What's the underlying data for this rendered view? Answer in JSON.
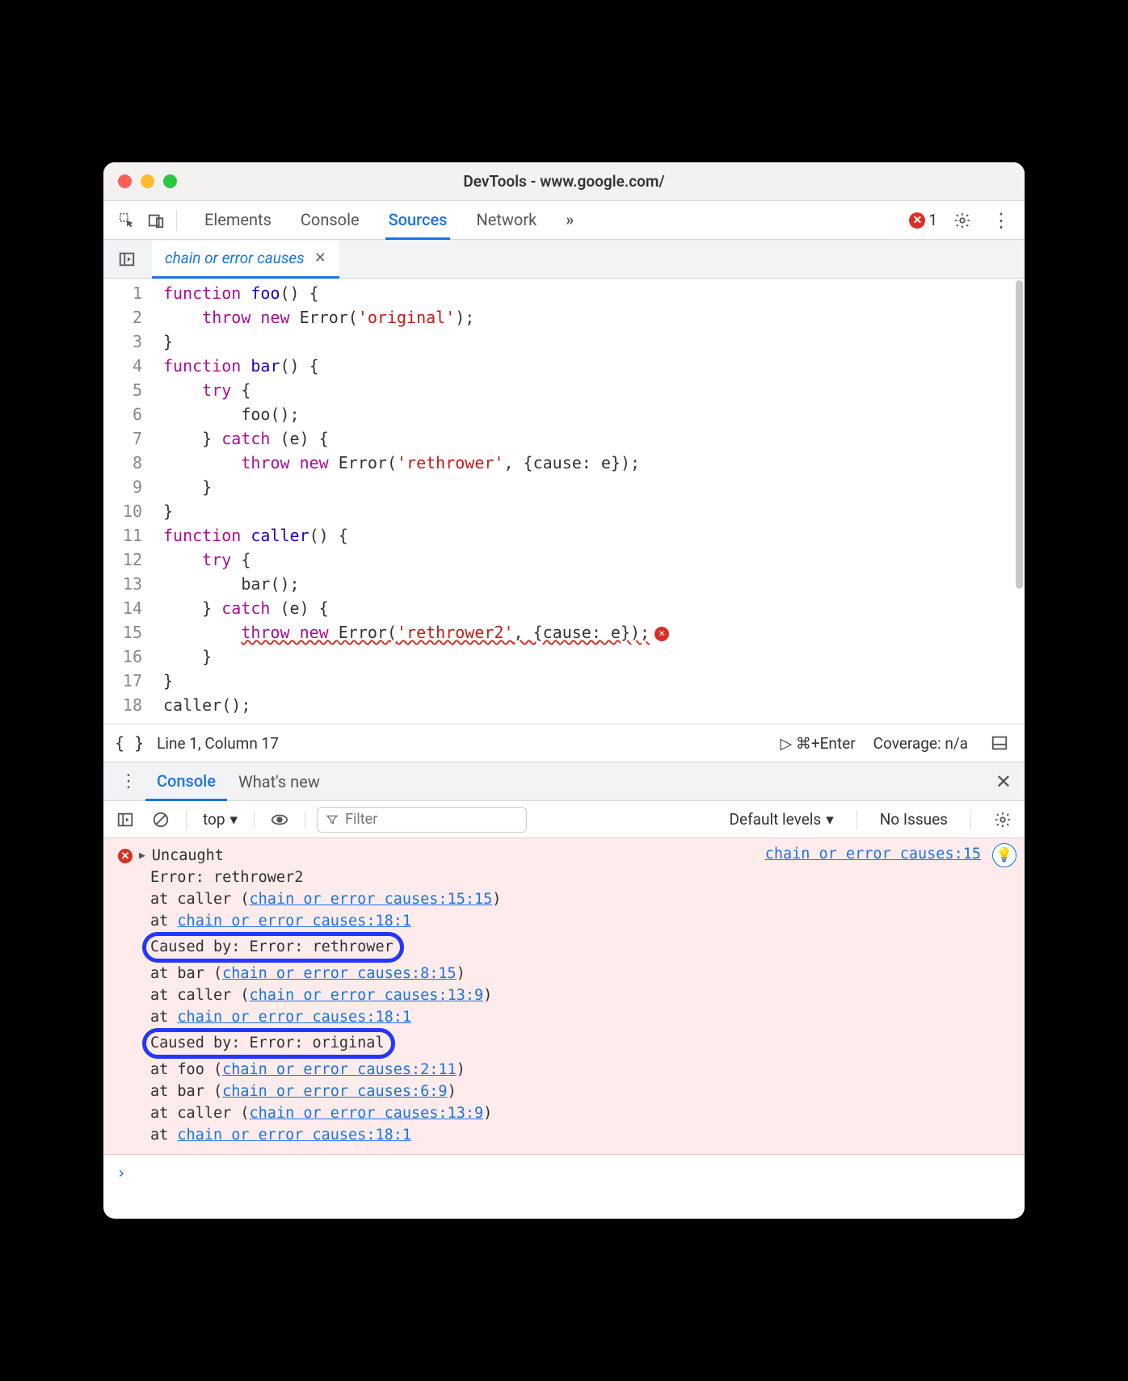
{
  "window": {
    "title": "DevTools - www.google.com/"
  },
  "toolbar": {
    "tabs": [
      "Elements",
      "Console",
      "Sources",
      "Network"
    ],
    "active_tab": "Sources",
    "overflow_glyph": "»",
    "error_count": "1"
  },
  "sources": {
    "file_tab": "chain or error causes",
    "code": {
      "lines": [
        {
          "n": "1",
          "tokens": [
            {
              "t": "function ",
              "c": "kw"
            },
            {
              "t": "foo",
              "c": "fn"
            },
            {
              "t": "() {",
              "c": "pn"
            }
          ]
        },
        {
          "n": "2",
          "tokens": [
            {
              "t": "    throw new ",
              "c": "kw"
            },
            {
              "t": "Error(",
              "c": "pn"
            },
            {
              "t": "'original'",
              "c": "str"
            },
            {
              "t": ");",
              "c": "pn"
            }
          ]
        },
        {
          "n": "3",
          "tokens": [
            {
              "t": "}",
              "c": "pn"
            }
          ]
        },
        {
          "n": "4",
          "tokens": [
            {
              "t": "function ",
              "c": "kw"
            },
            {
              "t": "bar",
              "c": "fn"
            },
            {
              "t": "() {",
              "c": "pn"
            }
          ]
        },
        {
          "n": "5",
          "tokens": [
            {
              "t": "    try ",
              "c": "kw"
            },
            {
              "t": "{",
              "c": "pn"
            }
          ]
        },
        {
          "n": "6",
          "tokens": [
            {
              "t": "        foo();",
              "c": "pn"
            }
          ]
        },
        {
          "n": "7",
          "tokens": [
            {
              "t": "    } ",
              "c": "pn"
            },
            {
              "t": "catch ",
              "c": "kw"
            },
            {
              "t": "(e) {",
              "c": "pn"
            }
          ]
        },
        {
          "n": "8",
          "tokens": [
            {
              "t": "        throw new ",
              "c": "kw"
            },
            {
              "t": "Error(",
              "c": "pn"
            },
            {
              "t": "'rethrower'",
              "c": "str"
            },
            {
              "t": ", {cause: e});",
              "c": "pn"
            }
          ]
        },
        {
          "n": "9",
          "tokens": [
            {
              "t": "    }",
              "c": "pn"
            }
          ]
        },
        {
          "n": "10",
          "tokens": [
            {
              "t": "}",
              "c": "pn"
            }
          ]
        },
        {
          "n": "11",
          "tokens": [
            {
              "t": "function ",
              "c": "kw"
            },
            {
              "t": "caller",
              "c": "fn"
            },
            {
              "t": "() {",
              "c": "pn"
            }
          ]
        },
        {
          "n": "12",
          "tokens": [
            {
              "t": "    try ",
              "c": "kw"
            },
            {
              "t": "{",
              "c": "pn"
            }
          ]
        },
        {
          "n": "13",
          "tokens": [
            {
              "t": "        bar();",
              "c": "pn"
            }
          ]
        },
        {
          "n": "14",
          "tokens": [
            {
              "t": "    } ",
              "c": "pn"
            },
            {
              "t": "catch ",
              "c": "kw"
            },
            {
              "t": "(e) {",
              "c": "pn"
            }
          ]
        },
        {
          "n": "15",
          "tokens": [
            {
              "t": "        ",
              "c": "pn"
            },
            {
              "t": "throw new ",
              "c": "kw",
              "sq": true
            },
            {
              "t": "Error(",
              "c": "pn",
              "sq": true
            },
            {
              "t": "'rethrower2'",
              "c": "str",
              "sq": true
            },
            {
              "t": ", {cause: e});",
              "c": "pn",
              "sq": true
            }
          ],
          "err": true
        },
        {
          "n": "16",
          "tokens": [
            {
              "t": "    }",
              "c": "pn"
            }
          ]
        },
        {
          "n": "17",
          "tokens": [
            {
              "t": "}",
              "c": "pn"
            }
          ]
        },
        {
          "n": "18",
          "tokens": [
            {
              "t": "caller();",
              "c": "pn"
            }
          ]
        }
      ]
    },
    "status": {
      "position": "Line 1, Column 17",
      "run_hint": "⌘+Enter",
      "coverage": "Coverage: n/a"
    }
  },
  "drawer": {
    "tabs": [
      "Console",
      "What's new"
    ],
    "active": "Console",
    "toolbar": {
      "context": "top",
      "filter_placeholder": "Filter",
      "levels": "Default levels",
      "issues": "No Issues"
    },
    "message": {
      "source_link": "chain or error causes:15",
      "head": "Uncaught",
      "lines": [
        {
          "text": "Error: rethrower2"
        },
        {
          "text": "    at caller (",
          "link": "chain or error causes:15:15",
          "tail": ")"
        },
        {
          "text": "    at ",
          "link": "chain or error causes:18:1"
        },
        {
          "cause": "Caused by: Error: rethrower"
        },
        {
          "text": "    at bar (",
          "link": "chain or error causes:8:15",
          "tail": ")"
        },
        {
          "text": "    at caller (",
          "link": "chain or error causes:13:9",
          "tail": ")"
        },
        {
          "text": "    at ",
          "link": "chain or error causes:18:1"
        },
        {
          "cause": "Caused by: Error: original"
        },
        {
          "text": "    at foo (",
          "link": "chain or error causes:2:11",
          "tail": ")"
        },
        {
          "text": "    at bar (",
          "link": "chain or error causes:6:9",
          "tail": ")"
        },
        {
          "text": "    at caller (",
          "link": "chain or error causes:13:9",
          "tail": ")"
        },
        {
          "text": "    at ",
          "link": "chain or error causes:18:1"
        }
      ]
    },
    "prompt_glyph": "›"
  }
}
